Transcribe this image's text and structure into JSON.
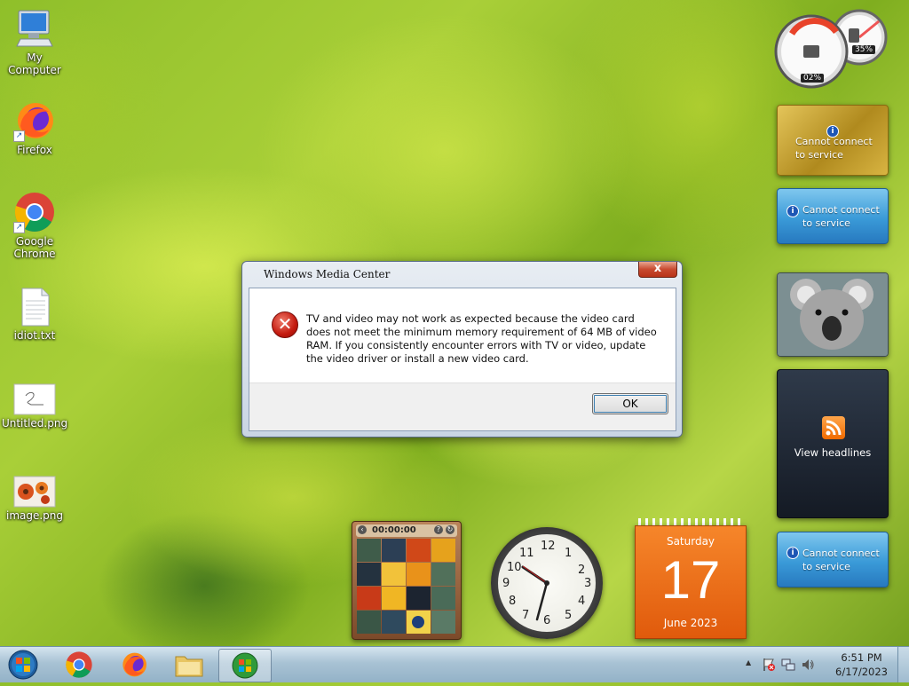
{
  "desktop": {
    "icons": [
      {
        "label": "My Computer",
        "icon": "computer-icon"
      },
      {
        "label": "Firefox",
        "icon": "firefox-icon"
      },
      {
        "label": "Google Chrome",
        "icon": "chrome-icon"
      },
      {
        "label": "idiot.txt",
        "icon": "text-file-icon"
      },
      {
        "label": "Untitled.png",
        "icon": "image-file-icon"
      },
      {
        "label": "image.png",
        "icon": "image-file-icon"
      }
    ]
  },
  "gadgets": {
    "cpu_meter": {
      "cpu": "02%",
      "memory": "35%"
    },
    "currency": {
      "message": "Cannot connect to service"
    },
    "weather": {
      "message": "Cannot connect to service"
    },
    "feed": {
      "label": "View headlines"
    },
    "stocks": {
      "message": "Cannot connect to service"
    },
    "puzzle": {
      "timer": "00:00:00"
    },
    "calendar": {
      "weekday": "Saturday",
      "day": "17",
      "month_year": "June 2023"
    },
    "clock": {
      "numbers": [
        "12",
        "1",
        "2",
        "3",
        "4",
        "5",
        "6",
        "7",
        "8",
        "9",
        "10",
        "11"
      ]
    }
  },
  "dialog": {
    "title": "Windows Media Center",
    "close_label": "x",
    "message": "TV and video may not work as expected because the video card does not meet the minimum memory requirement of 64 MB of video RAM. If you consistently encounter errors with TV or video, update the video driver or install a new video card.",
    "ok_label": "OK"
  },
  "taskbar": {
    "time": "6:51 PM",
    "date": "6/17/2023",
    "tray_arrow": "▲"
  },
  "colors": {
    "calendar_orange": "#e8590c",
    "dialog_close": "#c84a30"
  }
}
